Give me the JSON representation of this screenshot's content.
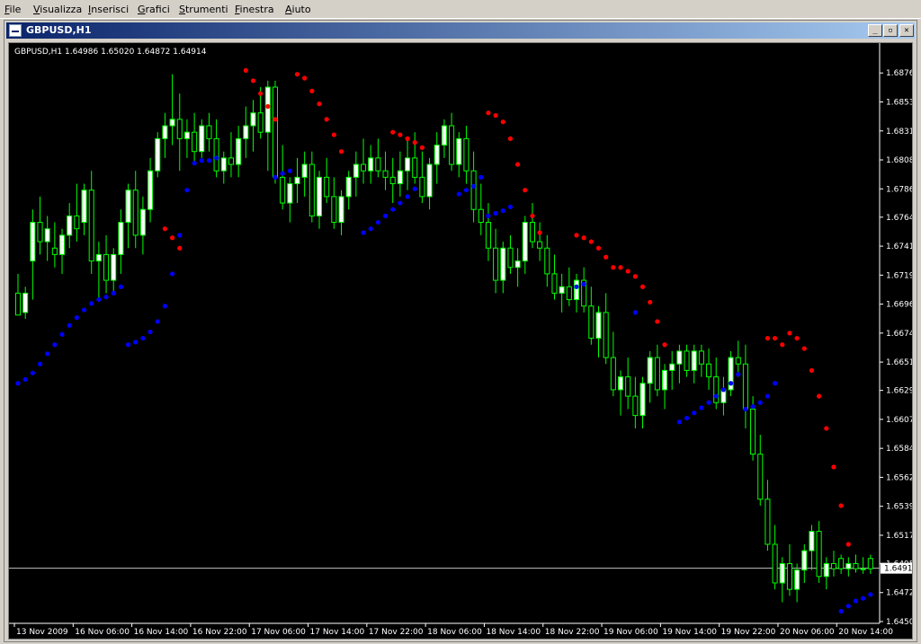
{
  "menu": [
    "File",
    "Visualizza",
    "Inserisci",
    "Grafici",
    "Strumenti",
    "Finestra",
    "Aiuto"
  ],
  "window": {
    "title": "GBPUSD,H1",
    "buttons": {
      "minimize": "_",
      "restore": "▫",
      "close": "✕"
    }
  },
  "chart": {
    "info_line": "GBPUSD,H1  1.64986 1.65020 1.64872 1.64914",
    "current_price": "1.64914",
    "price_axis_labels": [
      "1.68760",
      "1.68535",
      "1.68310",
      "1.68085",
      "1.67860",
      "1.67640",
      "1.67415",
      "1.67190",
      "1.66965",
      "1.66740",
      "1.66515",
      "1.66295",
      "1.66070",
      "1.65845",
      "1.65620",
      "1.65395",
      "1.65170",
      "1.64950",
      "1.64725",
      "1.64500"
    ],
    "time_axis_labels": [
      "13 Nov 2009",
      "16 Nov 06:00",
      "16 Nov 14:00",
      "16 Nov 22:00",
      "17 Nov 06:00",
      "17 Nov 14:00",
      "17 Nov 22:00",
      "18 Nov 06:00",
      "18 Nov 14:00",
      "18 Nov 22:00",
      "19 Nov 06:00",
      "19 Nov 14:00",
      "19 Nov 22:00",
      "20 Nov 06:00",
      "20 Nov 14:00"
    ],
    "colors": {
      "background": "#000000",
      "axis": "#ffffff",
      "bull_body": "#ffffff",
      "bear_body": "#000000",
      "wick": "#00ff00",
      "sar_above": "#ff0000",
      "sar_below": "#0000ff",
      "price_line": "#c0c0c0"
    }
  },
  "chart_data": {
    "type": "candlestick",
    "ylim": [
      1.645,
      1.6895
    ],
    "bar_count": 117,
    "candles": [
      [
        1.6705,
        1.672,
        1.669,
        1.6688
      ],
      [
        1.669,
        1.671,
        1.6685,
        1.6705
      ],
      [
        1.673,
        1.677,
        1.67,
        1.676
      ],
      [
        1.676,
        1.678,
        1.6735,
        1.6745
      ],
      [
        1.6745,
        1.6765,
        1.673,
        1.6755
      ],
      [
        1.674,
        1.676,
        1.6725,
        1.6735
      ],
      [
        1.6735,
        1.6755,
        1.672,
        1.675
      ],
      [
        1.675,
        1.6775,
        1.674,
        1.6765
      ],
      [
        1.6765,
        1.679,
        1.6745,
        1.6755
      ],
      [
        1.676,
        1.679,
        1.675,
        1.6785
      ],
      [
        1.6785,
        1.68,
        1.672,
        1.673
      ],
      [
        1.673,
        1.6745,
        1.67,
        1.6735
      ],
      [
        1.6735,
        1.675,
        1.6705,
        1.6715
      ],
      [
        1.6715,
        1.674,
        1.6705,
        1.6735
      ],
      [
        1.6735,
        1.677,
        1.672,
        1.676
      ],
      [
        1.676,
        1.679,
        1.674,
        1.6785
      ],
      [
        1.6785,
        1.68,
        1.674,
        1.675
      ],
      [
        1.675,
        1.678,
        1.6735,
        1.677
      ],
      [
        1.677,
        1.681,
        1.676,
        1.68
      ],
      [
        1.68,
        1.683,
        1.6795,
        1.6825
      ],
      [
        1.6825,
        1.6845,
        1.681,
        1.6835
      ],
      [
        1.6835,
        1.6875,
        1.682,
        1.684
      ],
      [
        1.684,
        1.686,
        1.68,
        1.6825
      ],
      [
        1.6825,
        1.684,
        1.681,
        1.683
      ],
      [
        1.683,
        1.6845,
        1.6805,
        1.6815
      ],
      [
        1.6815,
        1.684,
        1.681,
        1.6835
      ],
      [
        1.6835,
        1.6845,
        1.6815,
        1.6825
      ],
      [
        1.6825,
        1.684,
        1.6795,
        1.68
      ],
      [
        1.68,
        1.6815,
        1.679,
        1.681
      ],
      [
        1.681,
        1.683,
        1.6795,
        1.6805
      ],
      [
        1.6805,
        1.6835,
        1.6795,
        1.6825
      ],
      [
        1.6825,
        1.685,
        1.681,
        1.6835
      ],
      [
        1.6835,
        1.6855,
        1.6815,
        1.6845
      ],
      [
        1.6845,
        1.6865,
        1.6825,
        1.683
      ],
      [
        1.683,
        1.687,
        1.68,
        1.6865
      ],
      [
        1.6865,
        1.687,
        1.679,
        1.6795
      ],
      [
        1.6795,
        1.682,
        1.677,
        1.6775
      ],
      [
        1.6775,
        1.6795,
        1.676,
        1.679
      ],
      [
        1.679,
        1.681,
        1.6775,
        1.6795
      ],
      [
        1.6795,
        1.6815,
        1.678,
        1.6805
      ],
      [
        1.6805,
        1.6815,
        1.676,
        1.6765
      ],
      [
        1.6765,
        1.68,
        1.6755,
        1.6795
      ],
      [
        1.6795,
        1.681,
        1.6775,
        1.678
      ],
      [
        1.678,
        1.6795,
        1.6755,
        1.676
      ],
      [
        1.676,
        1.6785,
        1.675,
        1.678
      ],
      [
        1.678,
        1.68,
        1.677,
        1.6795
      ],
      [
        1.6795,
        1.6815,
        1.678,
        1.6805
      ],
      [
        1.6805,
        1.6825,
        1.679,
        1.68
      ],
      [
        1.68,
        1.682,
        1.679,
        1.681
      ],
      [
        1.681,
        1.6825,
        1.6795,
        1.68
      ],
      [
        1.68,
        1.6815,
        1.6785,
        1.6795
      ],
      [
        1.6795,
        1.681,
        1.6775,
        1.679
      ],
      [
        1.679,
        1.6815,
        1.678,
        1.68
      ],
      [
        1.68,
        1.6825,
        1.6785,
        1.681
      ],
      [
        1.681,
        1.683,
        1.679,
        1.6795
      ],
      [
        1.6795,
        1.6815,
        1.6775,
        1.678
      ],
      [
        1.678,
        1.681,
        1.677,
        1.6805
      ],
      [
        1.6805,
        1.683,
        1.679,
        1.682
      ],
      [
        1.682,
        1.684,
        1.681,
        1.6835
      ],
      [
        1.6835,
        1.6845,
        1.68,
        1.6805
      ],
      [
        1.6805,
        1.683,
        1.6795,
        1.6825
      ],
      [
        1.6825,
        1.6835,
        1.679,
        1.68
      ],
      [
        1.68,
        1.6815,
        1.676,
        1.677
      ],
      [
        1.677,
        1.679,
        1.675,
        1.676
      ],
      [
        1.676,
        1.6775,
        1.673,
        1.674
      ],
      [
        1.674,
        1.6755,
        1.6705,
        1.6715
      ],
      [
        1.6715,
        1.6745,
        1.6705,
        1.674
      ],
      [
        1.674,
        1.675,
        1.672,
        1.6725
      ],
      [
        1.6725,
        1.674,
        1.671,
        1.673
      ],
      [
        1.673,
        1.6765,
        1.672,
        1.676
      ],
      [
        1.676,
        1.6775,
        1.674,
        1.6745
      ],
      [
        1.6745,
        1.676,
        1.673,
        1.674
      ],
      [
        1.674,
        1.675,
        1.671,
        1.672
      ],
      [
        1.672,
        1.6735,
        1.67,
        1.6705
      ],
      [
        1.6705,
        1.672,
        1.669,
        1.671
      ],
      [
        1.671,
        1.6725,
        1.6695,
        1.67
      ],
      [
        1.67,
        1.672,
        1.669,
        1.6715
      ],
      [
        1.6715,
        1.6725,
        1.669,
        1.6695
      ],
      [
        1.6695,
        1.671,
        1.6665,
        1.667
      ],
      [
        1.667,
        1.6695,
        1.6655,
        1.669
      ],
      [
        1.669,
        1.6705,
        1.665,
        1.6655
      ],
      [
        1.6655,
        1.6675,
        1.6625,
        1.663
      ],
      [
        1.663,
        1.6645,
        1.661,
        1.664
      ],
      [
        1.664,
        1.6655,
        1.6615,
        1.6625
      ],
      [
        1.6625,
        1.664,
        1.66,
        1.661
      ],
      [
        1.661,
        1.664,
        1.66,
        1.6635
      ],
      [
        1.6635,
        1.666,
        1.662,
        1.6655
      ],
      [
        1.6655,
        1.6665,
        1.6625,
        1.663
      ],
      [
        1.663,
        1.665,
        1.6615,
        1.6645
      ],
      [
        1.6645,
        1.666,
        1.663,
        1.665
      ],
      [
        1.665,
        1.6665,
        1.6635,
        1.666
      ],
      [
        1.666,
        1.6665,
        1.664,
        1.6645
      ],
      [
        1.6645,
        1.6665,
        1.6635,
        1.666
      ],
      [
        1.666,
        1.6665,
        1.664,
        1.665
      ],
      [
        1.665,
        1.6662,
        1.663,
        1.664
      ],
      [
        1.664,
        1.6655,
        1.6615,
        1.662
      ],
      [
        1.662,
        1.664,
        1.661,
        1.663
      ],
      [
        1.663,
        1.666,
        1.6625,
        1.6655
      ],
      [
        1.6655,
        1.6668,
        1.664,
        1.665
      ],
      [
        1.665,
        1.6665,
        1.66,
        1.6615
      ],
      [
        1.6615,
        1.6625,
        1.6575,
        1.658
      ],
      [
        1.658,
        1.6595,
        1.654,
        1.6545
      ],
      [
        1.6545,
        1.656,
        1.6505,
        1.651
      ],
      [
        1.651,
        1.6525,
        1.6475,
        1.648
      ],
      [
        1.648,
        1.65,
        1.6465,
        1.6495
      ],
      [
        1.6495,
        1.651,
        1.647,
        1.6475
      ],
      [
        1.6475,
        1.6495,
        1.6465,
        1.649
      ],
      [
        1.649,
        1.651,
        1.648,
        1.6505
      ],
      [
        1.6505,
        1.6525,
        1.649,
        1.652
      ],
      [
        1.652,
        1.6528,
        1.648,
        1.6485
      ],
      [
        1.6485,
        1.65,
        1.6475,
        1.6495
      ],
      [
        1.6495,
        1.6505,
        1.6485,
        1.6491
      ],
      [
        1.6499,
        1.6502,
        1.6487,
        1.6491
      ],
      [
        1.6491,
        1.65,
        1.6485,
        1.6495
      ],
      [
        1.6495,
        1.6502,
        1.6488,
        1.6491
      ],
      [
        1.6491,
        1.65,
        1.6487,
        1.6491
      ],
      [
        1.6499,
        1.6502,
        1.6487,
        1.6491
      ]
    ],
    "sar_above": [
      [
        20,
        1.6755
      ],
      [
        21,
        1.6748
      ],
      [
        22,
        1.674
      ],
      [
        31,
        1.6878
      ],
      [
        32,
        1.687
      ],
      [
        33,
        1.686
      ],
      [
        34,
        1.685
      ],
      [
        35,
        1.684
      ],
      [
        38,
        1.6875
      ],
      [
        39,
        1.6872
      ],
      [
        40,
        1.6862
      ],
      [
        41,
        1.6852
      ],
      [
        42,
        1.684
      ],
      [
        43,
        1.6828
      ],
      [
        44,
        1.6815
      ],
      [
        51,
        1.683
      ],
      [
        52,
        1.6828
      ],
      [
        53,
        1.6825
      ],
      [
        54,
        1.6822
      ],
      [
        55,
        1.6818
      ],
      [
        64,
        1.6845
      ],
      [
        65,
        1.6843
      ],
      [
        66,
        1.6838
      ],
      [
        67,
        1.6825
      ],
      [
        68,
        1.6805
      ],
      [
        69,
        1.6785
      ],
      [
        70,
        1.6765
      ],
      [
        71,
        1.6752
      ],
      [
        76,
        1.675
      ],
      [
        77,
        1.6748
      ],
      [
        78,
        1.6745
      ],
      [
        79,
        1.674
      ],
      [
        80,
        1.6733
      ],
      [
        81,
        1.6725
      ],
      [
        82,
        1.6725
      ],
      [
        83,
        1.6722
      ],
      [
        84,
        1.6718
      ],
      [
        85,
        1.671
      ],
      [
        86,
        1.6698
      ],
      [
        87,
        1.6683
      ],
      [
        88,
        1.6665
      ],
      [
        102,
        1.667
      ],
      [
        103,
        1.667
      ],
      [
        104,
        1.6665
      ],
      [
        105,
        1.6674
      ],
      [
        106,
        1.667
      ],
      [
        107,
        1.6662
      ],
      [
        108,
        1.6645
      ],
      [
        109,
        1.6625
      ],
      [
        110,
        1.66
      ],
      [
        111,
        1.657
      ],
      [
        112,
        1.654
      ],
      [
        113,
        1.651
      ]
    ],
    "sar_below": [
      [
        0,
        1.6635
      ],
      [
        1,
        1.6638
      ],
      [
        2,
        1.6643
      ],
      [
        3,
        1.665
      ],
      [
        4,
        1.6658
      ],
      [
        5,
        1.6665
      ],
      [
        6,
        1.6673
      ],
      [
        7,
        1.668
      ],
      [
        8,
        1.6686
      ],
      [
        9,
        1.6692
      ],
      [
        10,
        1.6697
      ],
      [
        11,
        1.67
      ],
      [
        12,
        1.6702
      ],
      [
        13,
        1.6705
      ],
      [
        14,
        1.671
      ],
      [
        15,
        1.6665
      ],
      [
        16,
        1.6667
      ],
      [
        17,
        1.667
      ],
      [
        18,
        1.6675
      ],
      [
        19,
        1.6683
      ],
      [
        20,
        1.6695
      ],
      [
        21,
        1.672
      ],
      [
        22,
        1.675
      ],
      [
        23,
        1.6785
      ],
      [
        24,
        1.6806
      ],
      [
        25,
        1.6808
      ],
      [
        26,
        1.6808
      ],
      [
        27,
        1.681
      ],
      [
        35,
        1.6795
      ],
      [
        36,
        1.6798
      ],
      [
        37,
        1.68
      ],
      [
        47,
        1.6752
      ],
      [
        48,
        1.6755
      ],
      [
        49,
        1.676
      ],
      [
        50,
        1.6765
      ],
      [
        51,
        1.677
      ],
      [
        52,
        1.6775
      ],
      [
        53,
        1.678
      ],
      [
        54,
        1.6786
      ],
      [
        60,
        1.6782
      ],
      [
        61,
        1.6785
      ],
      [
        62,
        1.6788
      ],
      [
        63,
        1.6795
      ],
      [
        64,
        1.6765
      ],
      [
        65,
        1.6767
      ],
      [
        66,
        1.6769
      ],
      [
        67,
        1.6772
      ],
      [
        76,
        1.671
      ],
      [
        77,
        1.6712
      ],
      [
        84,
        1.669
      ],
      [
        90,
        1.6605
      ],
      [
        91,
        1.6608
      ],
      [
        92,
        1.6612
      ],
      [
        93,
        1.6616
      ],
      [
        94,
        1.662
      ],
      [
        95,
        1.6625
      ],
      [
        96,
        1.663
      ],
      [
        97,
        1.6635
      ],
      [
        98,
        1.6642
      ],
      [
        99,
        1.6615
      ],
      [
        100,
        1.6617
      ],
      [
        101,
        1.662
      ],
      [
        102,
        1.6625
      ],
      [
        103,
        1.6635
      ],
      [
        112,
        1.6458
      ],
      [
        113,
        1.6462
      ],
      [
        114,
        1.6466
      ],
      [
        115,
        1.6468
      ],
      [
        116,
        1.6471
      ]
    ]
  }
}
